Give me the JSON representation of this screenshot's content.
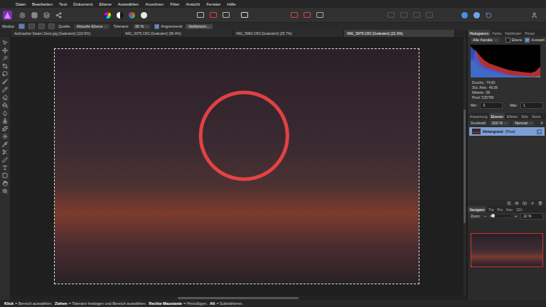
{
  "menu": [
    "Datei",
    "Bearbeiten",
    "Text",
    "Dokument",
    "Ebene",
    "Auswählen",
    "Anordnen",
    "Filter",
    "Ansicht",
    "Fenster",
    "Hilfe"
  ],
  "context_bar": {
    "mode_label": "Modus:",
    "modes": [
      {
        "selected": true
      },
      {
        "selected": false
      },
      {
        "selected": false
      },
      {
        "selected": false
      }
    ],
    "source_label": "Quelle:",
    "source_value": "Aktuelle Ebene",
    "tolerance_label": "Toleranz:",
    "tolerance_value": "30 %",
    "contiguous": {
      "label": "Angrenzend",
      "checked": true
    },
    "refine_button": "Verfeinern..."
  },
  "document_tabs": [
    {
      "label": "Aufmacher Steam Deck.jpg [Geändert] (119.5%)",
      "selected": false
    },
    {
      "label": "IMG_0075.CR2 [Geändert] (95.4%)",
      "selected": false
    },
    {
      "label": "IMG_5960.CR2 [Geändert] (25.7%)",
      "selected": false
    },
    {
      "label": "IMG_5979.CR2 [Geändert] (22.3%)",
      "selected": true
    }
  ],
  "canvas": {
    "selection_active": true
  },
  "histogram_panel": {
    "tabs": [
      {
        "label": "Histogramm",
        "selected": true
      },
      {
        "label": "Farbe",
        "selected": false
      },
      {
        "label": "Farbfinder",
        "selected": false
      },
      {
        "label": "Pinsel",
        "selected": false
      }
    ],
    "channel": "Alle Kanäle",
    "options": [
      {
        "label": "Ebene",
        "checked": false
      },
      {
        "label": "Auswahl",
        "checked": true
      }
    ],
    "chart": {
      "series": [
        {
          "color": "#e03a3a",
          "values": [
            0.3,
            0.9,
            0.7,
            0.55,
            0.45,
            0.4,
            0.35,
            0.3,
            0.25,
            0.22,
            0.2,
            0.18,
            0.16,
            0.15,
            0.2,
            0.35
          ]
        },
        {
          "color": "#3fbf4a",
          "values": [
            0.6,
            0.5,
            0.35,
            0.25,
            0.2,
            0.15,
            0.12,
            0.1,
            0.08,
            0.06,
            0.05,
            0.04,
            0.04,
            0.03,
            0.03,
            0.05
          ]
        },
        {
          "color": "#3a5ee8",
          "values": [
            1,
            0.85,
            0.5,
            0.35,
            0.3,
            0.25,
            0.2,
            0.15,
            0.1,
            0.08,
            0.06,
            0.05,
            0.04,
            0.03,
            0.02,
            0.01
          ]
        }
      ]
    },
    "stats": [
      "Durchs.: 74,82",
      "Std. Abw.: 49,36",
      "Mittelw.: 58",
      "Pixel: 535768"
    ],
    "min": {
      "label": "Min:",
      "value": "0"
    },
    "max": {
      "label": "Max:",
      "value": "1"
    }
  },
  "layers_panel": {
    "tabs": [
      {
        "label": "Anpassung",
        "selected": false
      },
      {
        "label": "Ebenen",
        "selected": true
      },
      {
        "label": "Effekte",
        "selected": false
      },
      {
        "label": "Stile",
        "selected": false
      },
      {
        "label": "Stock",
        "selected": false
      }
    ],
    "opacity_label": "Deckkraft:",
    "opacity_value": "100 %",
    "blend_mode": "Normal",
    "layers": [
      {
        "name": "Hintergrund",
        "type": "(Pixel)",
        "selected": true,
        "visible": true
      }
    ]
  },
  "navigator_panel": {
    "tabs": [
      {
        "label": "Navigator",
        "selected": true
      },
      {
        "label": "Tra",
        "selected": false
      },
      {
        "label": "Pro",
        "selected": false
      },
      {
        "label": "Kan",
        "selected": false
      },
      {
        "label": "32V",
        "selected": false
      }
    ],
    "zoom_label": "Zoom:",
    "zoom_value": "22 %",
    "zoom_level": 0.12
  },
  "status_bar": [
    {
      "key": "Klick",
      "text": "= Bereich auswählen."
    },
    {
      "key": "Ziehen",
      "text": "= Toleranz festlegen und Bereich auswählen."
    },
    {
      "key": "Rechte Maustaste",
      "text": "= Hinzufügen."
    },
    {
      "key": "Alt",
      "text": "= Subtrahieren."
    }
  ]
}
